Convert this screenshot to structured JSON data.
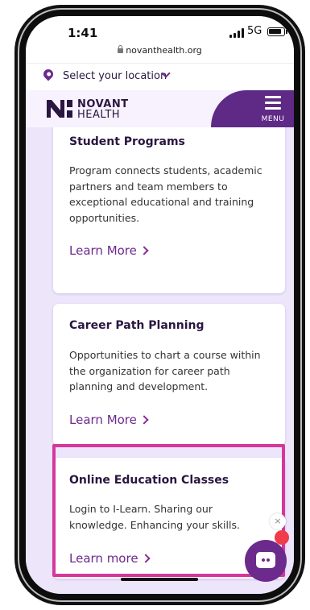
{
  "status_bar": {
    "time": "1:41",
    "network": "5G",
    "url": "novanthealth.org"
  },
  "location": {
    "label": "Select your location"
  },
  "header": {
    "logo_line1": "NOVANT",
    "logo_line2": "HEALTH",
    "menu_label": "MENU"
  },
  "cards": [
    {
      "title": "Student Programs",
      "description": "Program connects students, academic partners and team members to exceptional educational and training opportunities.",
      "link": "Learn More"
    },
    {
      "title": "Career Path Planning",
      "description": "Opportunities to chart a course within the organization for career path planning and development.",
      "link": "Learn More"
    },
    {
      "title": "Online Education Classes",
      "description": "Login to I-Learn. Sharing our knowledge. Enhancing your skills.",
      "link": "Learn more"
    }
  ],
  "colors": {
    "brand_purple": "#5e2a86",
    "highlight": "#d6379a",
    "background": "#ede6fb"
  }
}
